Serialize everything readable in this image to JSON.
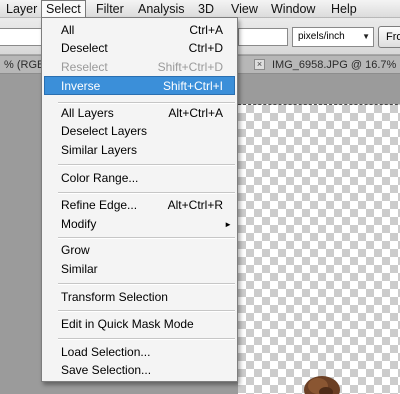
{
  "menubar": {
    "items": [
      "Layer",
      "Select",
      "Filter",
      "Analysis",
      "3D",
      "View",
      "Window",
      "Help"
    ]
  },
  "options": {
    "units_select": "pixels/inch",
    "front_button": "Fro"
  },
  "tabs": {
    "left_tab": "% (RGB/8",
    "right_tab": "IMG_6958.JPG @ 16.7%"
  },
  "select_menu": {
    "items": [
      {
        "label": "All",
        "shortcut": "Ctrl+A"
      },
      {
        "label": "Deselect",
        "shortcut": "Ctrl+D"
      },
      {
        "label": "Reselect",
        "shortcut": "Shift+Ctrl+D",
        "disabled": true
      },
      {
        "label": "Inverse",
        "shortcut": "Shift+Ctrl+I",
        "highlighted": true
      },
      {
        "label": "All Layers",
        "shortcut": "Alt+Ctrl+A"
      },
      {
        "label": "Deselect Layers",
        "shortcut": ""
      },
      {
        "label": "Similar Layers",
        "shortcut": ""
      },
      {
        "label": "Color Range...",
        "shortcut": ""
      },
      {
        "label": "Refine Edge...",
        "shortcut": "Alt+Ctrl+R"
      },
      {
        "label": "Modify",
        "shortcut": "",
        "submenu": true
      },
      {
        "label": "Grow",
        "shortcut": ""
      },
      {
        "label": "Similar",
        "shortcut": ""
      },
      {
        "label": "Transform Selection",
        "shortcut": ""
      },
      {
        "label": "Edit in Quick Mask Mode",
        "shortcut": ""
      },
      {
        "label": "Load Selection...",
        "shortcut": ""
      },
      {
        "label": "Save Selection...",
        "shortcut": ""
      }
    ]
  },
  "colors": {
    "highlight": "#3b8fd9",
    "menu_bg": "#f4f4f4",
    "workspace": "#9b9b9b"
  }
}
